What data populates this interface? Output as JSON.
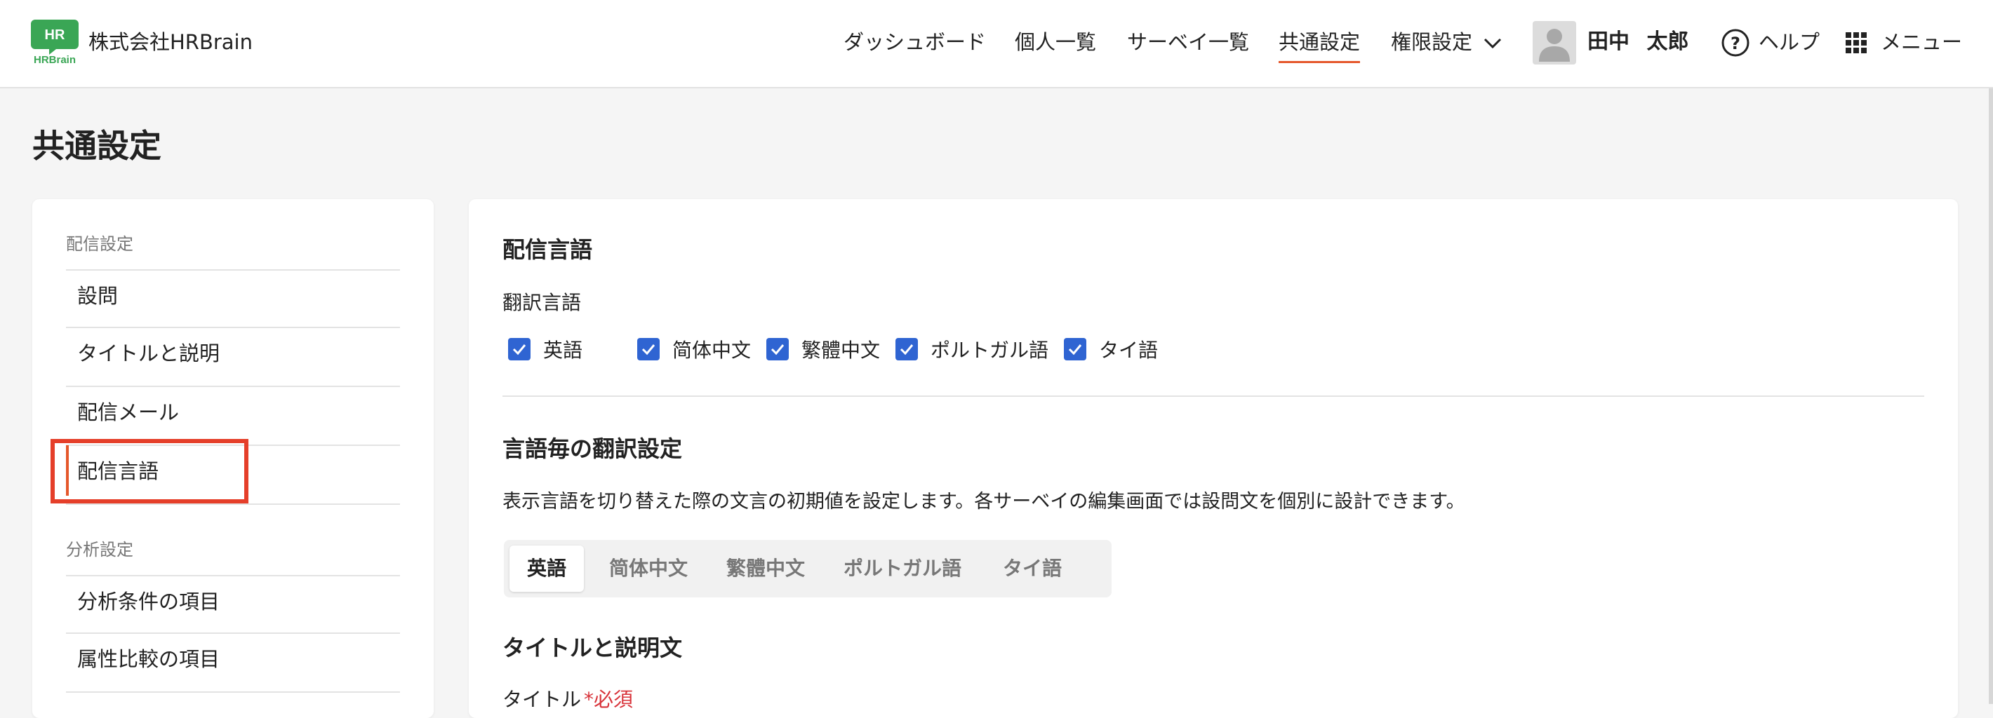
{
  "header": {
    "logo_text_top": "HR",
    "logo_text_bottom": "HRBrain",
    "company": "株式会社HRBrain",
    "nav": [
      {
        "label": "ダッシュボード"
      },
      {
        "label": "個人一覧"
      },
      {
        "label": "サーベイ一覧"
      },
      {
        "label": "共通設定"
      },
      {
        "label": "権限設定"
      }
    ],
    "user_name": "田中 太郎",
    "help_label": "ヘルプ",
    "menu_label": "メニュー"
  },
  "page_title": "共通設定",
  "sidebar": {
    "sections": [
      {
        "title": "配信設定",
        "items": [
          "設問",
          "タイトルと説明",
          "配信メール",
          "配信言語"
        ]
      },
      {
        "title": "分析設定",
        "items": [
          "分析条件の項目",
          "属性比較の項目"
        ]
      }
    ]
  },
  "main": {
    "section1_title": "配信言語",
    "translation_label": "翻訳言語",
    "languages": [
      {
        "label": "英語",
        "checked": true
      },
      {
        "label": "简体中文",
        "checked": true
      },
      {
        "label": "繁體中文",
        "checked": true
      },
      {
        "label": "ポルトガル語",
        "checked": true
      },
      {
        "label": "タイ語",
        "checked": true
      }
    ],
    "section2_title": "言語毎の翻訳設定",
    "section2_desc": "表示言語を切り替えた際の文言の初期値を設定します。各サーベイの編集画面では設問文を個別に設計できます。",
    "tabs": [
      "英語",
      "简体中文",
      "繁體中文",
      "ポルトガル語",
      "タイ語"
    ],
    "section3_title": "タイトルと説明文",
    "title_field_label": "タイトル",
    "required_label": "*必須"
  },
  "colors": {
    "accent": "#e5572b",
    "checkbox": "#2f64d2",
    "logo_green": "#3aa655",
    "highlight": "#e53f2a"
  }
}
